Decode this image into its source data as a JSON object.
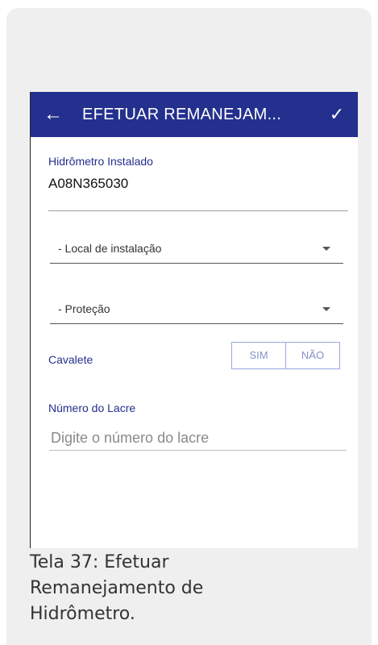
{
  "appbar": {
    "title": "EFETUAR REMANEJAM...",
    "back_icon": "arrow-left",
    "confirm_icon": "checkmark",
    "color": "#24308d"
  },
  "form": {
    "hidrometro_label": "Hidrômetro Instalado",
    "hidrometro_value": "A08N365030",
    "local_instalacao": "- Local de instalação",
    "protecao": "- Proteção",
    "cavalete_label": "Cavalete",
    "cavalete_options": [
      "SIM",
      "NÃO"
    ],
    "lacre_label": "Número do Lacre",
    "lacre_placeholder": "Digite o número do lacre"
  },
  "caption": "Tela 37: Efetuar Remanejamento de Hidrômetro."
}
